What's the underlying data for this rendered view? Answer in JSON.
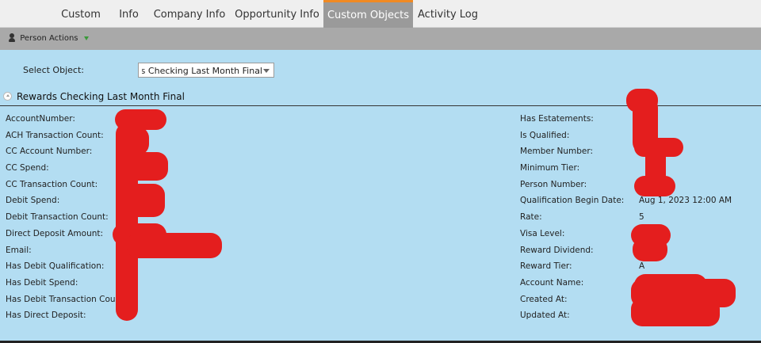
{
  "tabs": [
    {
      "label": "Custom"
    },
    {
      "label": "Info"
    },
    {
      "label": "Company Info"
    },
    {
      "label": "Opportunity Info"
    },
    {
      "label": "Custom Objects",
      "active": true
    },
    {
      "label": "Activity Log"
    }
  ],
  "actions": {
    "person_actions_label": "Person Actions"
  },
  "select_object": {
    "label": "Select Object:",
    "value": "Rewards Checking Last Month Final"
  },
  "section": {
    "title": "Rewards Checking Last Month Final"
  },
  "left_fields": [
    {
      "label": "AccountNumber:",
      "value": ""
    },
    {
      "label": "ACH Transaction Count:",
      "value": ""
    },
    {
      "label": "CC Account Number:",
      "value": ""
    },
    {
      "label": "CC Spend:",
      "value": ""
    },
    {
      "label": "CC Transaction Count:",
      "value": ""
    },
    {
      "label": "Debit Spend:",
      "value": ""
    },
    {
      "label": "Debit Transaction Count:",
      "value": ""
    },
    {
      "label": "Direct Deposit Amount:",
      "value": ""
    },
    {
      "label": "Email:",
      "value": ""
    },
    {
      "label": "Has Debit Qualification:",
      "value": ""
    },
    {
      "label": "Has Debit Spend:",
      "value": ""
    },
    {
      "label": "Has Debit Transaction Count:",
      "value": ""
    },
    {
      "label": "Has Direct Deposit:",
      "value": ""
    }
  ],
  "right_fields": [
    {
      "label": "Has Estatements:",
      "value": ""
    },
    {
      "label": "Is Qualified:",
      "value": ""
    },
    {
      "label": "Member Number:",
      "value": ""
    },
    {
      "label": "Minimum Tier:",
      "value": ""
    },
    {
      "label": "Person Number:",
      "value": ""
    },
    {
      "label": "Qualification Begin Date:",
      "value": "Aug 1, 2023 12:00 AM"
    },
    {
      "label": "Rate:",
      "value": "5"
    },
    {
      "label": "Visa Level:",
      "value": ""
    },
    {
      "label": "Reward Dividend:",
      "value": ""
    },
    {
      "label": "Reward Tier:",
      "value": "A"
    },
    {
      "label": "Account Name:",
      "value": ""
    },
    {
      "label": "Created At:",
      "value": ""
    },
    {
      "label": "Updated At:",
      "value": ""
    }
  ],
  "colors": {
    "accent": "#f08a24",
    "background": "#b3ddf2",
    "redaction": "#e41e1e"
  }
}
